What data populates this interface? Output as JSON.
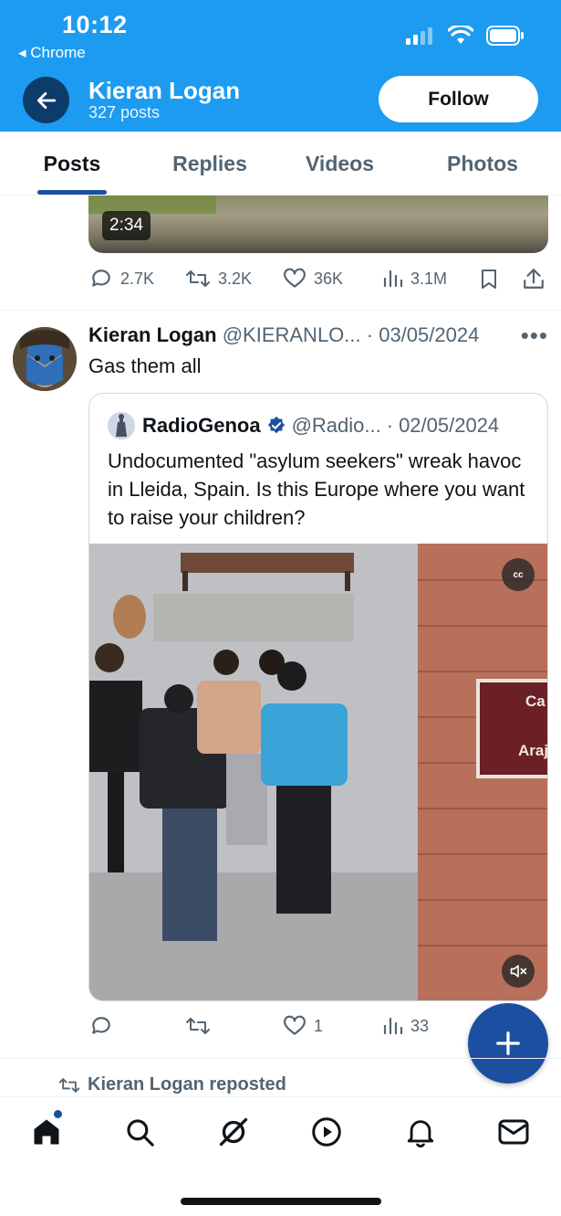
{
  "status_bar": {
    "time": "10:12",
    "back_app": "Chrome"
  },
  "header": {
    "name": "Kieran Logan",
    "posts_count": "327 posts",
    "follow_label": "Follow"
  },
  "tabs": [
    {
      "label": "Posts",
      "active": true
    },
    {
      "label": "Replies",
      "active": false
    },
    {
      "label": "Videos",
      "active": false
    },
    {
      "label": "Photos",
      "active": false
    }
  ],
  "previous_post": {
    "video_duration": "2:34",
    "replies": "2.7K",
    "reposts": "3.2K",
    "likes": "36K",
    "views": "3.1M"
  },
  "tweet": {
    "name": "Kieran Logan",
    "handle": "@KIERANLO...",
    "date": "03/05/2024",
    "text": "Gas them all",
    "quote": {
      "name": "RadioGenoa",
      "handle": "@Radio...",
      "date": "02/05/2024",
      "text": "Undocumented \"asylum seekers\" wreak havoc in Lleida, Spain. Is this Europe where you want to raise your children?",
      "cc_label": "cc",
      "sign_text_1": "Ca",
      "sign_text_2": "Araj"
    },
    "actions": {
      "replies": "",
      "reposts": "",
      "likes": "1",
      "views": "33"
    }
  },
  "repost_line": "Kieran Logan reposted",
  "colors": {
    "header_bg": "#1d9bf0",
    "accent": "#1d4fa0",
    "muted": "#536471"
  }
}
